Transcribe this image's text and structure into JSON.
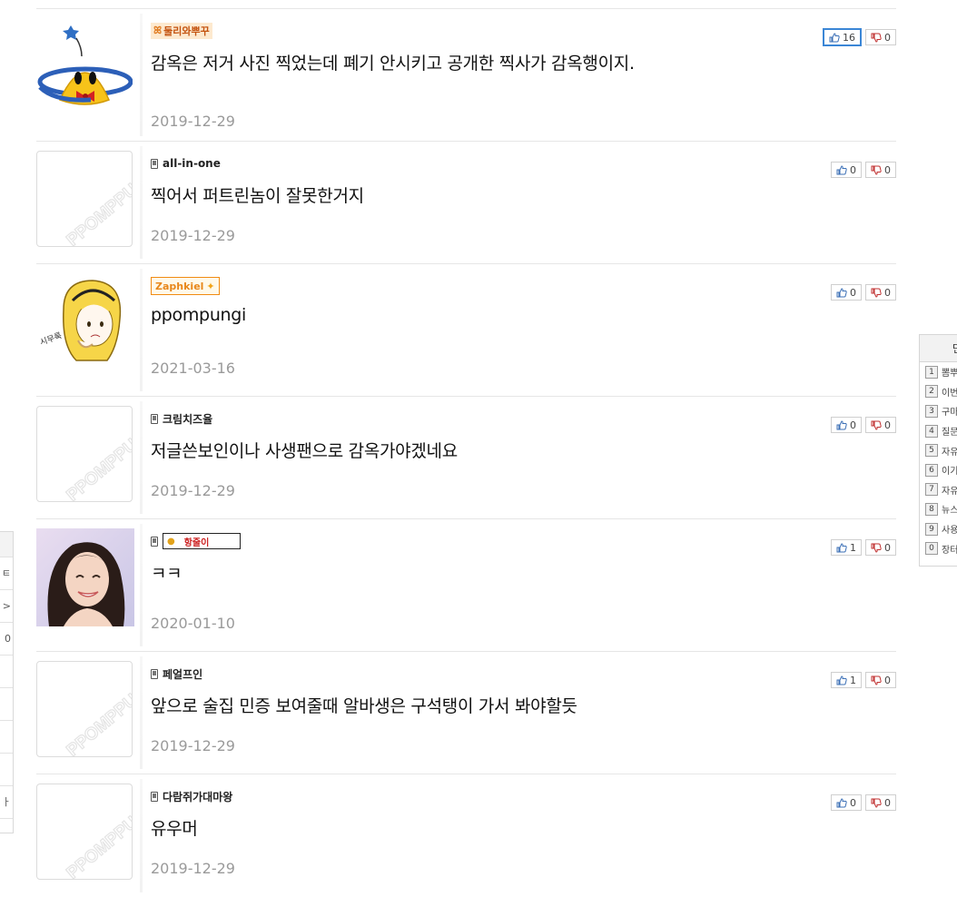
{
  "comments": [
    {
      "nickname": "둘리와뿌꾸",
      "nick_style": "image-orange",
      "text": "감옥은 저거 사진 찍었는데 폐기 안시키고 공개한 찍사가 감옥행이지.",
      "date": "2019-12-29",
      "up": "16",
      "down": "0",
      "avatar": "ufo-cartoon"
    },
    {
      "nickname": "all-in-one",
      "nick_style": "text",
      "text": "찍어서 퍼트린놈이 잘못한거지",
      "date": "2019-12-29",
      "up": "0",
      "down": "0",
      "avatar": "ppomppu-default"
    },
    {
      "nickname": "Zaphkiel",
      "nick_style": "image-zaph",
      "text": "ppompungi",
      "date": "2021-03-16",
      "up": "0",
      "down": "0",
      "avatar": "blonde-girl-drawing"
    },
    {
      "nickname": "크림치즈율",
      "nick_style": "text",
      "text": "저글쓴보인이나 사생팬으로 감옥가야겠네요",
      "date": "2019-12-29",
      "up": "0",
      "down": "0",
      "avatar": "ppomppu-default"
    },
    {
      "nickname": "항줄이",
      "nick_style": "image-box",
      "text": "ㅋㅋ",
      "date": "2020-01-10",
      "up": "1",
      "down": "0",
      "avatar": "photo-woman"
    },
    {
      "nickname": "페얼프인",
      "nick_style": "text",
      "text": "앞으로 술집 민증 보여줄때 알바생은 구석탱이 가서 봐야할듯",
      "date": "2019-12-29",
      "up": "1",
      "down": "0",
      "avatar": "ppomppu-default"
    },
    {
      "nickname": "다람쥐가대마왕",
      "nick_style": "text",
      "text": "유우머",
      "date": "2019-12-29",
      "up": "0",
      "down": "0",
      "avatar": "ppomppu-default"
    }
  ],
  "default_avatar_watermark": "PPOMPPU",
  "right_panel": {
    "head": "만",
    "ranks": [
      {
        "num": "1",
        "label": "뽐뿌"
      },
      {
        "num": "2",
        "label": "이번"
      },
      {
        "num": "3",
        "label": "구마"
      },
      {
        "num": "4",
        "label": "질문"
      },
      {
        "num": "5",
        "label": "자유"
      },
      {
        "num": "6",
        "label": "이기"
      },
      {
        "num": "7",
        "label": "자유"
      },
      {
        "num": "8",
        "label": "뉴스"
      },
      {
        "num": "9",
        "label": "사용"
      },
      {
        "num": "0",
        "label": "장터"
      }
    ]
  },
  "left_panel": {
    "cells": [
      "",
      "ㅌ",
      ">",
      "0",
      "",
      "",
      "",
      "",
      "ㅏ"
    ]
  },
  "colors": {
    "active_vote_border": "#3b86d6",
    "date_gray": "#9a9a9a"
  }
}
